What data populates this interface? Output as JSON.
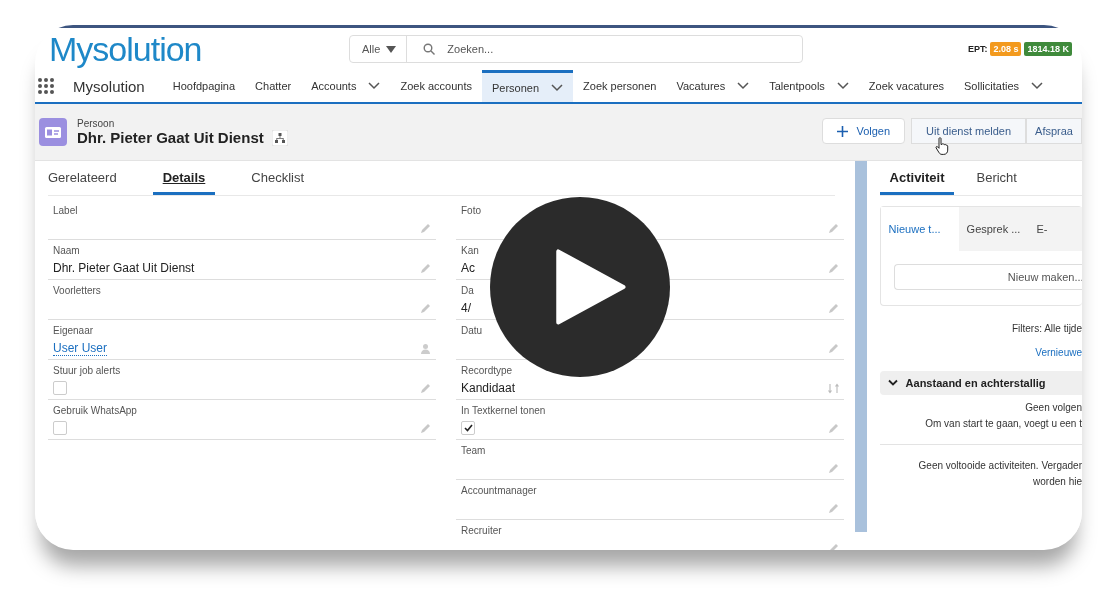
{
  "header": {
    "logo": "Mysolution",
    "search": {
      "scope": "Alle",
      "placeholder": "Zoeken..."
    },
    "ept_label": "EPT:",
    "badges": [
      {
        "text": "2.08 s",
        "color": "#f39a1e"
      },
      {
        "text": "1814.18 K",
        "color": "#3f8a3b"
      }
    ]
  },
  "nav": {
    "app_name": "Mysolution",
    "items": [
      {
        "label": "Hoofdpagina",
        "dropdown": false,
        "selected": false
      },
      {
        "label": "Chatter",
        "dropdown": false,
        "selected": false
      },
      {
        "label": "Accounts",
        "dropdown": true,
        "selected": false
      },
      {
        "label": "Zoek accounts",
        "dropdown": false,
        "selected": false
      },
      {
        "label": "Personen",
        "dropdown": true,
        "selected": true
      },
      {
        "label": "Zoek personen",
        "dropdown": false,
        "selected": false
      },
      {
        "label": "Vacatures",
        "dropdown": true,
        "selected": false
      },
      {
        "label": "Talentpools",
        "dropdown": true,
        "selected": false
      },
      {
        "label": "Zoek vacatures",
        "dropdown": false,
        "selected": false
      },
      {
        "label": "Sollicitaties",
        "dropdown": true,
        "selected": false
      }
    ]
  },
  "record": {
    "object": "Persoon",
    "name": "Dhr. Pieter Gaat Uit Dienst",
    "buttons": [
      {
        "label": "Volgen",
        "kind": "follow"
      },
      {
        "label": "Uit dienst melden",
        "kind": "plain"
      },
      {
        "label": "Afspraa",
        "kind": "plain"
      }
    ]
  },
  "tabs": [
    {
      "label": "Gerelateerd",
      "selected": false
    },
    {
      "label": "Details",
      "selected": true
    },
    {
      "label": "Checklist",
      "selected": false
    }
  ],
  "fields_left": [
    {
      "label": "Label",
      "kind": "text"
    },
    {
      "label": "Naam",
      "kind": "text",
      "value": "Dhr. Pieter Gaat Uit Dienst"
    },
    {
      "label": "Voorletters",
      "kind": "text"
    },
    {
      "label": "Eigenaar",
      "kind": "link",
      "value": "User User"
    },
    {
      "label": "Stuur job alerts",
      "kind": "checkbox",
      "checked": false
    },
    {
      "label": "Gebruik WhatsApp",
      "kind": "checkbox",
      "checked": false
    }
  ],
  "fields_right": [
    {
      "label": "Foto",
      "kind": "text"
    },
    {
      "label": "Kan",
      "kind": "text",
      "value": "Ac"
    },
    {
      "label": "Da",
      "kind": "text",
      "value": "4/"
    },
    {
      "label": "Datu",
      "kind": "text"
    },
    {
      "label": "Recordtype",
      "kind": "recordtype",
      "value": "Kandidaat"
    },
    {
      "label": "In Textkernel tonen",
      "kind": "checkbox",
      "checked": true
    },
    {
      "label": "Team",
      "kind": "text"
    },
    {
      "label": "Accountmanager",
      "kind": "text"
    },
    {
      "label": "Recruiter",
      "kind": "text"
    }
  ],
  "activity": {
    "tabs": [
      {
        "label": "Activiteit",
        "selected": true
      },
      {
        "label": "Bericht",
        "selected": false
      }
    ],
    "subtabs": [
      {
        "label": "Nieuwe t...",
        "selected": true
      },
      {
        "label": "Gesprek ...",
        "selected": false
      },
      {
        "label": "E-",
        "selected": false
      }
    ],
    "new_button": "Nieuw maken...",
    "filters": "Filters: Alle tijde",
    "refresh": "Vernieuwe",
    "section": {
      "title": "Aanstaand en achterstallig",
      "expanded": true,
      "lines": [
        "Geen volgen",
        "Om van start te gaan, voegt u een t"
      ]
    },
    "completed": [
      "Geen voltooide activiteiten. Vergader",
      "worden hie"
    ]
  }
}
